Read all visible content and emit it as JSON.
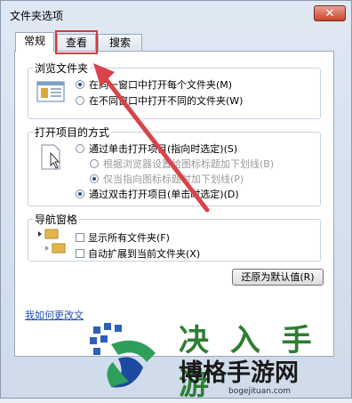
{
  "window": {
    "title": "文件夹选项",
    "close_label": "✕"
  },
  "tabs": [
    "常规",
    "查看",
    "搜索"
  ],
  "browse": {
    "label": "浏览文件夹",
    "options": [
      "在同一窗口中打开每个文件夹(M)",
      "在不同窗口中打开不同的文件夹(W)"
    ]
  },
  "open_items": {
    "label": "打开项目的方式",
    "options": [
      "通过单击打开项目(指向时选定)(S)",
      "根据浏览器设置给图标标题加下划线(B)",
      "仅当指向图标标题时加下划线(P)",
      "通过双击打开项目(单击时选定)(D)"
    ]
  },
  "nav": {
    "label": "导航窗格",
    "options": [
      "显示所有文件夹(F)",
      "自动扩展到当前文件夹(X)"
    ]
  },
  "restore_button": "还原为默认值(R)",
  "help_link": "我如何更改文",
  "watermark": {
    "text1": "决 入 手 游",
    "text2": "博格手游网",
    "url": "bogejituan.com"
  },
  "colors": {
    "highlight": "#d33b3b",
    "arrow": "#d9434a",
    "link": "#1f4fb3"
  }
}
